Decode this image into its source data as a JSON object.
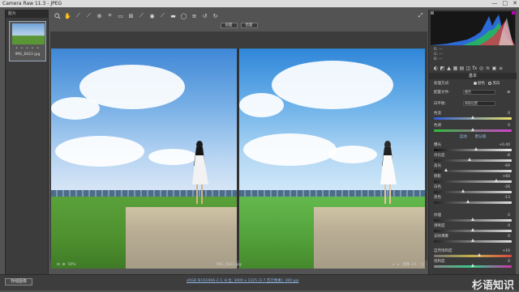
{
  "window": {
    "title": "Camera Raw 11.3 - JPEG",
    "controls": [
      "—",
      "□",
      "✕"
    ]
  },
  "filmstrip": {
    "header": "胶片",
    "thumb_name": "IMG_6022.jpg",
    "stars": "• • • • •"
  },
  "toolbar": {
    "icons": [
      "zoom-icon",
      "hand-icon",
      "white-balance-icon",
      "color-sampler-icon",
      "target-adjust-icon",
      "crop-icon",
      "straighten-icon",
      "transform-icon",
      "spot-removal-icon",
      "red-eye-icon",
      "adjustment-brush-icon",
      "graduated-filter-icon",
      "radial-filter-icon",
      "preferences-icon",
      "rotate-left-icon",
      "rotate-right-icon"
    ],
    "fullscreen": "⤢"
  },
  "compare_tabs": {
    "before": "前面",
    "after": "后面"
  },
  "status": {
    "zoom": "50%",
    "filename": "IMG_6022.jpg",
    "image_count": "图像 1/1"
  },
  "bottom": {
    "save_button": "存储图像",
    "workflow_link": "sRGB IEC61966-2.1; 8 位; 3000 x 1225 (3.7 百万像素); 300 ppi",
    "watermark": "杉语知识"
  },
  "histogram": {
    "rgb_labels": [
      "R: ---",
      "G: ---",
      "B: ---"
    ]
  },
  "panel": {
    "section_title": "基本",
    "treatment_label": "处理方式:",
    "treatment_options": [
      "颜色",
      "黑白"
    ],
    "profile_label": "配置文件:",
    "profile_value": "颜色",
    "wb_label": "白平衡:",
    "wb_value": "原照设置",
    "sliders": [
      {
        "label": "色温",
        "value": "0"
      },
      {
        "label": "色调",
        "value": "0"
      },
      {
        "label": "曝光",
        "value": "+0.40"
      },
      {
        "label": "对比度",
        "value": "-8"
      },
      {
        "label": "高光",
        "value": "-69"
      },
      {
        "label": "阴影",
        "value": "+60"
      },
      {
        "label": "白色",
        "value": "-26"
      },
      {
        "label": "黑色",
        "value": "-13"
      },
      {
        "label": "纹理",
        "value": "0"
      },
      {
        "label": "清晰度",
        "value": "0"
      },
      {
        "label": "去除薄雾",
        "value": "0"
      },
      {
        "label": "自然饱和度",
        "value": "+16"
      },
      {
        "label": "饱和度",
        "value": "0"
      }
    ],
    "auto_link": "自动",
    "default_link": "默认值"
  }
}
